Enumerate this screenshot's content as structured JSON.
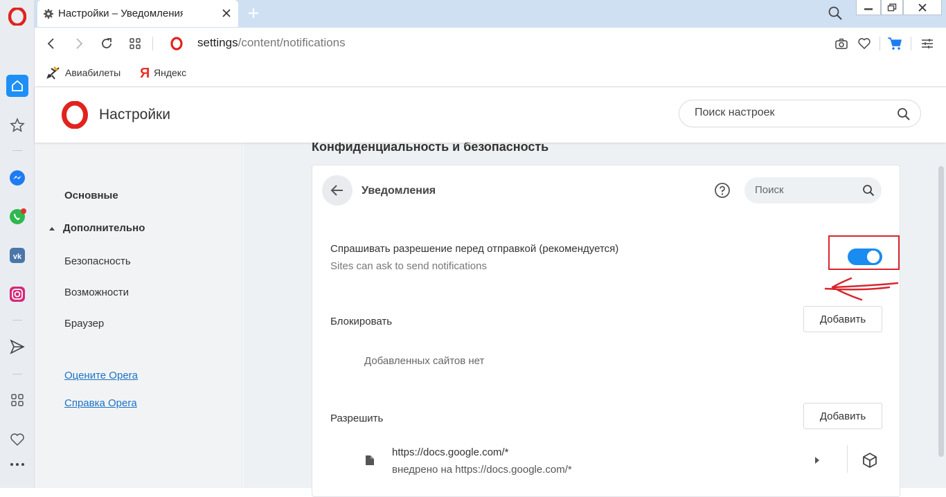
{
  "browser": {
    "tab": {
      "title": "Настройки – Уведомления"
    },
    "address": {
      "host": "settings",
      "path": "/content/notifications"
    },
    "bookmarks": [
      {
        "label": "Авиабилеты"
      },
      {
        "label": "Яндекс"
      }
    ]
  },
  "settings": {
    "title": "Настройки",
    "search_placeholder": "Поиск настроек"
  },
  "sidebar": {
    "items": [
      {
        "label": "Основные"
      },
      {
        "label": "Дополнительно"
      },
      {
        "label": "Безопасность"
      },
      {
        "label": "Возможности"
      },
      {
        "label": "Браузер"
      }
    ],
    "links": [
      {
        "label": "Оцените Opera"
      },
      {
        "label": "Справка Opera"
      }
    ]
  },
  "main": {
    "section_title": "Конфиденциальность и безопасность",
    "card_title": "Уведомления",
    "search_placeholder": "Поиск",
    "ask_permission": {
      "label": "Спрашивать разрешение перед отправкой (рекомендуется)",
      "sublabel": "Sites can ask to send notifications",
      "enabled": true
    },
    "block": {
      "title": "Блокировать",
      "add_label": "Добавить",
      "empty_text": "Добавленных сайтов нет"
    },
    "allow": {
      "title": "Разрешить",
      "add_label": "Добавить",
      "sites": [
        {
          "url": "https://docs.google.com/*",
          "embedded": "внедрено на https://docs.google.com/*"
        }
      ]
    }
  },
  "colors": {
    "accent": "#1a8cf0",
    "highlight": "#d8262e",
    "opera_red": "#e1231d"
  },
  "icons": [
    "opera-logo-icon",
    "home-icon",
    "star-icon",
    "messenger-icon",
    "whatsapp-icon",
    "vk-icon",
    "instagram-icon",
    "send-icon",
    "grid-icon",
    "heart-icon",
    "more-icon",
    "gear-icon",
    "close-icon",
    "plus-icon",
    "search-icon",
    "back-icon",
    "forward-icon",
    "reload-icon",
    "camera-icon",
    "cart-icon",
    "easy-setup-icon",
    "plane-icon",
    "yandex-icon",
    "help-icon",
    "file-icon",
    "chevron-right-icon",
    "cube-icon"
  ]
}
